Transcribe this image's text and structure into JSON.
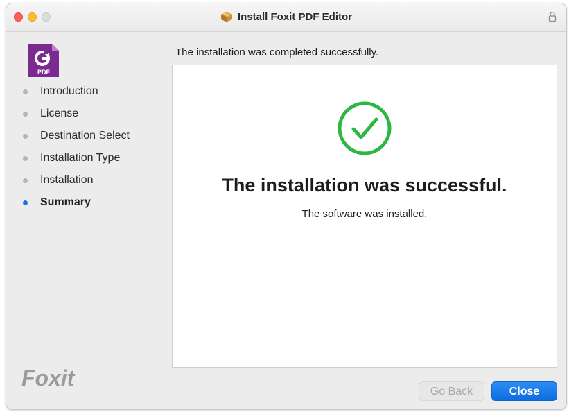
{
  "window": {
    "title": "Install Foxit PDF Editor"
  },
  "app_icon": {
    "label": "PDF",
    "color": "#7b2a8f"
  },
  "sidebar": {
    "items": [
      {
        "label": "Introduction",
        "active": false
      },
      {
        "label": "License",
        "active": false
      },
      {
        "label": "Destination Select",
        "active": false
      },
      {
        "label": "Installation Type",
        "active": false
      },
      {
        "label": "Installation",
        "active": false
      },
      {
        "label": "Summary",
        "active": true
      }
    ],
    "logo_text": "Foxit"
  },
  "main": {
    "heading": "The installation was completed successfully.",
    "success_title": "The installation was successful.",
    "success_subtitle": "The software was installed.",
    "success_icon": "checkmark-circle-icon",
    "success_color": "#2cb742"
  },
  "buttons": {
    "back_label": "Go Back",
    "back_enabled": false,
    "close_label": "Close",
    "accent_color": "#1a73e8"
  }
}
